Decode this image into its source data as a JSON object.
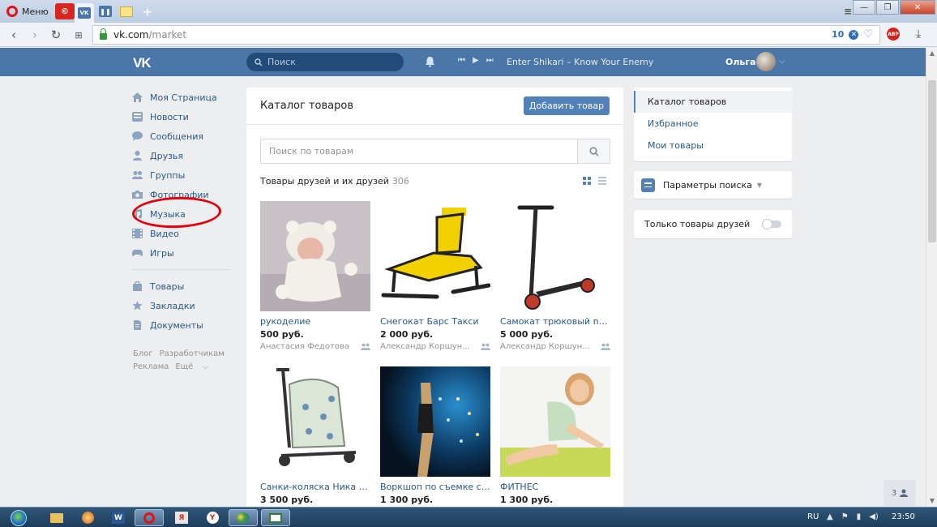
{
  "browser": {
    "menu_label": "Меню",
    "url_host": "vk.com",
    "url_path": "/market",
    "badge_count": "10"
  },
  "header": {
    "logo": "VK",
    "search_placeholder": "Поиск",
    "track": "Enter Shikari – Know Your Enemy",
    "user_name": "Ольга"
  },
  "sidebar": {
    "items": [
      {
        "label": "Моя Страница",
        "icon": "home-icon"
      },
      {
        "label": "Новости",
        "icon": "news-icon"
      },
      {
        "label": "Сообщения",
        "icon": "messages-icon"
      },
      {
        "label": "Друзья",
        "icon": "friends-icon"
      },
      {
        "label": "Группы",
        "icon": "groups-icon"
      },
      {
        "label": "Фотографии",
        "icon": "camera-icon"
      },
      {
        "label": "Музыка",
        "icon": "music-icon"
      },
      {
        "label": "Видео",
        "icon": "video-icon"
      },
      {
        "label": "Игры",
        "icon": "gamepad-icon"
      }
    ],
    "items2": [
      {
        "label": "Товары",
        "icon": "bag-icon"
      },
      {
        "label": "Закладки",
        "icon": "star-icon"
      },
      {
        "label": "Документы",
        "icon": "document-icon"
      }
    ],
    "footer": [
      "Блог",
      "Разработчикам",
      "Реклама",
      "Ещё"
    ]
  },
  "main": {
    "title": "Каталог товаров",
    "add_button": "Добавить товар",
    "search_placeholder": "Поиск по товарам",
    "section_title": "Товары друзей и их друзей",
    "section_count": "306",
    "products": [
      {
        "name": "рукоделие",
        "price": "500 руб.",
        "seller": "Анастасия Федотова"
      },
      {
        "name": "Снегокат Барс Такси",
        "price": "2 000 руб.",
        "seller": "Александр Коршун..."
      },
      {
        "name": "Самокат трюковый nova...",
        "price": "5 000 руб.",
        "seller": "Александр Коршун..."
      },
      {
        "name": "Санки-коляска Ника На...",
        "price": "3 500 руб.",
        "seller": ""
      },
      {
        "name": "Воркшоп по съемке с но...",
        "price": "1 300 руб.",
        "seller": ""
      },
      {
        "name": "ФИТНЕС",
        "price": "1 300 руб.",
        "seller": ""
      }
    ]
  },
  "right": {
    "menu": [
      "Каталог товаров",
      "Избранное",
      "Мои товары"
    ],
    "params": "Параметры поиска",
    "friends_only": "Только товары друзей"
  },
  "chat_count": "3",
  "taskbar": {
    "lang": "RU",
    "clock": "23:50"
  },
  "colors": {
    "vk_blue": "#4a76a8",
    "link": "#2a5885",
    "button": "#5181b8",
    "annotation_red": "#e4000f"
  }
}
